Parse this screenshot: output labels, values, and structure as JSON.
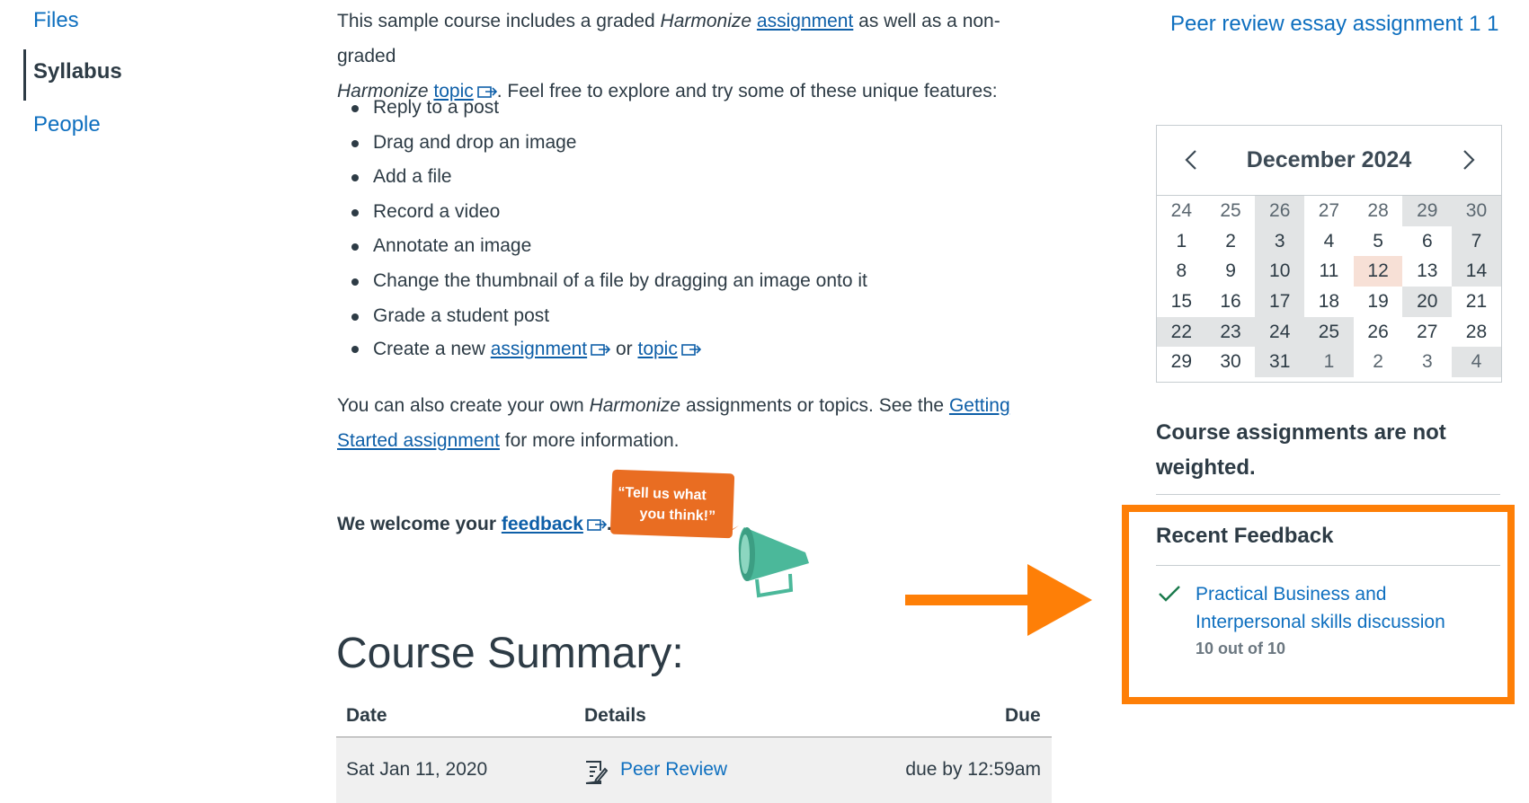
{
  "nav": {
    "files": "Files",
    "syllabus": "Syllabus",
    "people": "People"
  },
  "main": {
    "intro": {
      "t1": "This sample course includes a graded ",
      "t2": "Harmonize",
      "t3": " ",
      "assignment_link": "assignment",
      "t4": " as well as a non-graded",
      "t5": "Harmonize",
      "t6": " ",
      "topic_link": "topic",
      "t7": ".  Feel free to explore and try some of these unique features:"
    },
    "features": [
      "Reply to a post",
      "Drag and drop an image",
      "Add a file",
      "Record a video",
      "Annotate an image",
      "Change the thumbnail of a file by dragging an image onto it",
      "Grade a student post"
    ],
    "create_item": {
      "prefix": "Create a new ",
      "assignment_link": "assignment",
      "or": " or ",
      "topic_link": "topic"
    },
    "also": {
      "t1": "You can also create your own ",
      "t2": "Harmonize",
      "t3": " assignments or topics.  See the ",
      "link_line1": "Getting",
      "link_line2": "Started assignment",
      "t4": " for more information."
    },
    "welcome": {
      "prefix": "We welcome your ",
      "link": "feedback",
      "suffix": "."
    },
    "bubble": {
      "line1": "“Tell us what",
      "line2": "you think!”"
    },
    "summary_title": "Course Summary:",
    "table": {
      "headers": {
        "date": "Date",
        "details": "Details",
        "due": "Due"
      },
      "rows": [
        {
          "date": "Sat Jan 11, 2020",
          "details": "Peer Review",
          "due": "due by 12:59am"
        }
      ]
    }
  },
  "sidebar": {
    "peer_link": "Peer review essay assignment 1 1",
    "calendar": {
      "title": "December 2024",
      "days": [
        {
          "d": "24",
          "s": "other"
        },
        {
          "d": "25",
          "s": "other"
        },
        {
          "d": "26",
          "s": "other shade"
        },
        {
          "d": "27",
          "s": "other"
        },
        {
          "d": "28",
          "s": "other"
        },
        {
          "d": "29",
          "s": "other shade"
        },
        {
          "d": "30",
          "s": "other shade"
        },
        {
          "d": "1",
          "s": ""
        },
        {
          "d": "2",
          "s": ""
        },
        {
          "d": "3",
          "s": "shade"
        },
        {
          "d": "4",
          "s": ""
        },
        {
          "d": "5",
          "s": ""
        },
        {
          "d": "6",
          "s": ""
        },
        {
          "d": "7",
          "s": "shade"
        },
        {
          "d": "8",
          "s": ""
        },
        {
          "d": "9",
          "s": ""
        },
        {
          "d": "10",
          "s": "shade"
        },
        {
          "d": "11",
          "s": ""
        },
        {
          "d": "12",
          "s": "today"
        },
        {
          "d": "13",
          "s": ""
        },
        {
          "d": "14",
          "s": "shade"
        },
        {
          "d": "15",
          "s": ""
        },
        {
          "d": "16",
          "s": ""
        },
        {
          "d": "17",
          "s": "shade"
        },
        {
          "d": "18",
          "s": ""
        },
        {
          "d": "19",
          "s": ""
        },
        {
          "d": "20",
          "s": "shade"
        },
        {
          "d": "21",
          "s": ""
        },
        {
          "d": "22",
          "s": "shade"
        },
        {
          "d": "23",
          "s": "shade"
        },
        {
          "d": "24",
          "s": "shade"
        },
        {
          "d": "25",
          "s": "shade"
        },
        {
          "d": "26",
          "s": ""
        },
        {
          "d": "27",
          "s": ""
        },
        {
          "d": "28",
          "s": ""
        },
        {
          "d": "29",
          "s": ""
        },
        {
          "d": "30",
          "s": ""
        },
        {
          "d": "31",
          "s": "shade"
        },
        {
          "d": "1",
          "s": "other shade"
        },
        {
          "d": "2",
          "s": "other"
        },
        {
          "d": "3",
          "s": "other"
        },
        {
          "d": "4",
          "s": "other shade"
        }
      ]
    },
    "weight_note": "Course assignments are not weighted.",
    "recent_feedback": {
      "title": "Recent Feedback",
      "item_link": "Practical Business and Interpersonal skills discussion",
      "score": "10 out of 10"
    }
  },
  "colors": {
    "highlight_box": "#fe7f07",
    "link": "#0e6fbf",
    "bubble": "#e96d22",
    "megaphone": "#4bb89a",
    "check": "#1a7a4c"
  }
}
